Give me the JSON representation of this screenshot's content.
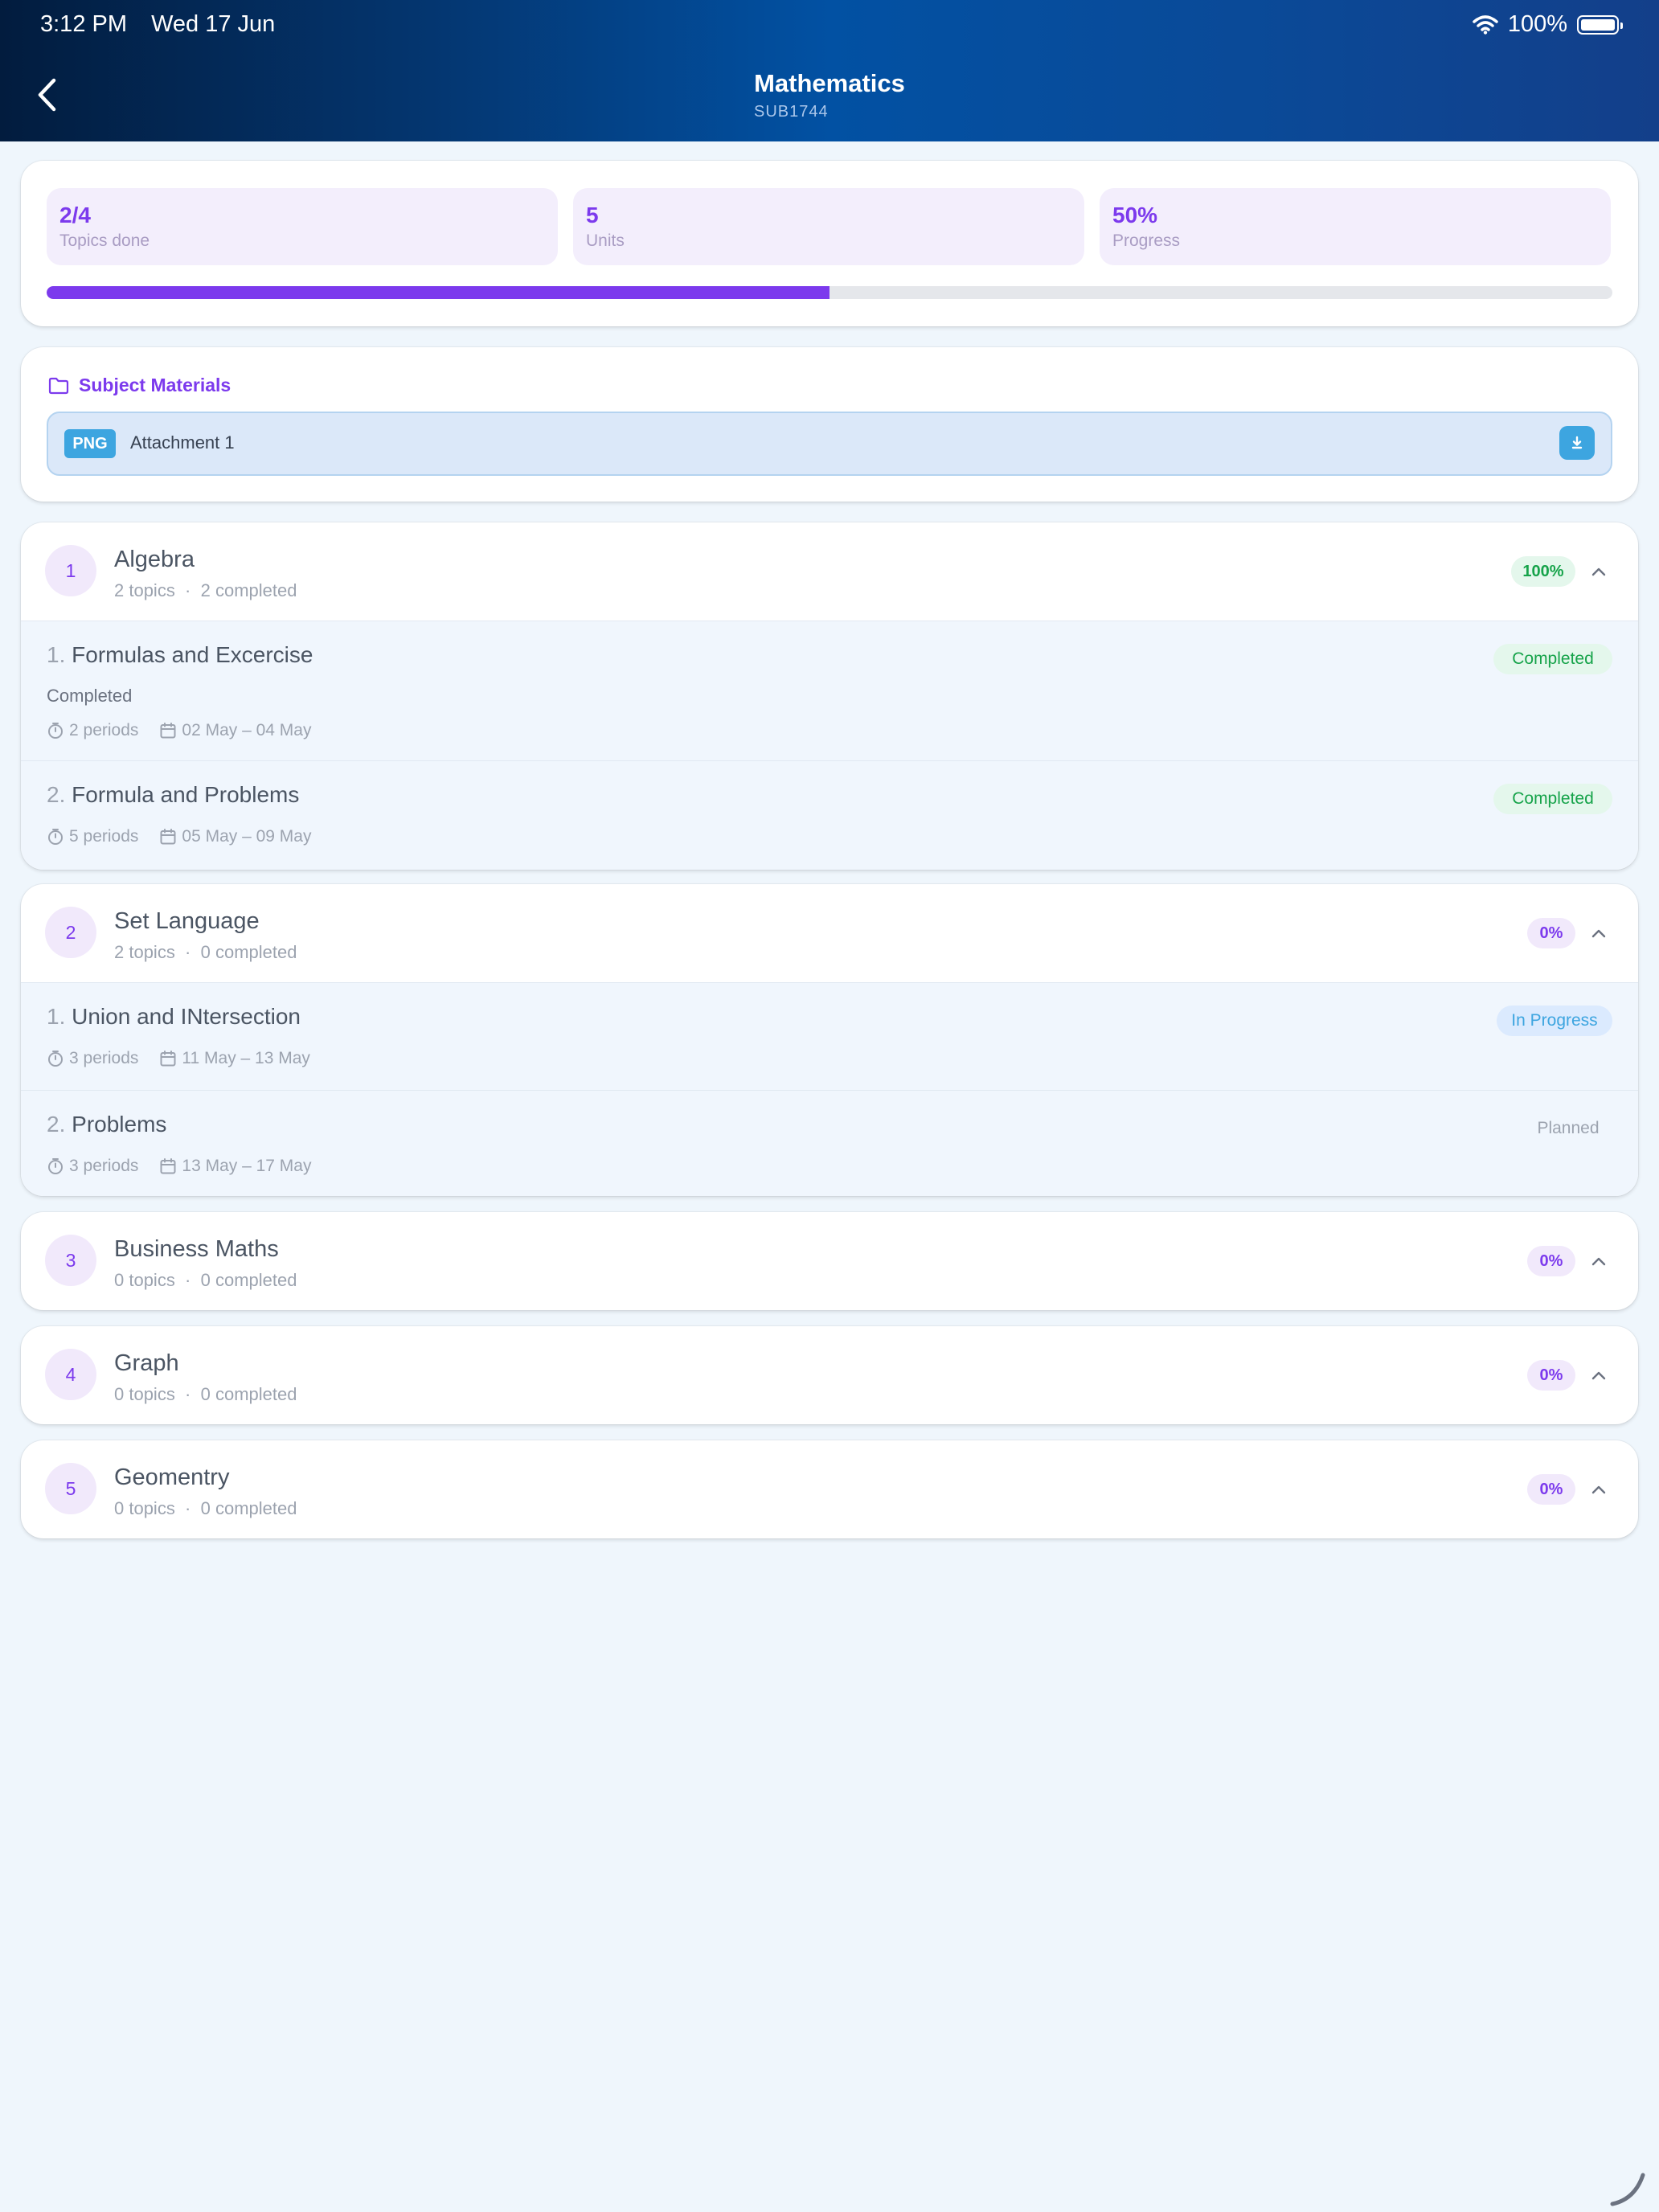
{
  "status_bar": {
    "time": "3:12 PM",
    "date": "Wed 17 Jun",
    "battery": "100%"
  },
  "header": {
    "title": "Mathematics",
    "code": "SUB1744"
  },
  "summary": {
    "stats": [
      {
        "value": "2/4",
        "label": "Topics done"
      },
      {
        "value": "5",
        "label": "Units"
      },
      {
        "value": "50%",
        "label": "Progress"
      }
    ],
    "progress_fraction": 0.5
  },
  "materials": {
    "title": "Subject Materials",
    "attachments": [
      {
        "type": "PNG",
        "name": "Attachment 1"
      }
    ]
  },
  "units": [
    {
      "number": "1",
      "name": "Algebra",
      "topics": "2 topics",
      "completed": "2 completed",
      "percent": "100%",
      "topic_items": [
        {
          "index": "1.",
          "title": "Formulas and Excercise",
          "status": "Completed",
          "note": "Completed",
          "periods": "2 periods",
          "dates": "02 May – 04 May"
        },
        {
          "index": "2.",
          "title": "Formula and Problems",
          "status": "Completed",
          "periods": "5 periods",
          "dates": "05 May – 09 May"
        }
      ]
    },
    {
      "number": "2",
      "name": "Set Language",
      "topics": "2 topics",
      "completed": "0 completed",
      "percent": "0%",
      "topic_items": [
        {
          "index": "1.",
          "title": "Union and INtersection",
          "status": "In Progress",
          "periods": "3 periods",
          "dates": "11 May – 13 May"
        },
        {
          "index": "2.",
          "title": "Problems",
          "status": "Planned",
          "periods": "3 periods",
          "dates": "13 May – 17 May"
        }
      ]
    },
    {
      "number": "3",
      "name": "Business Maths",
      "topics": "0 topics",
      "completed": "0 completed",
      "percent": "0%"
    },
    {
      "number": "4",
      "name": "Graph",
      "topics": "0 topics",
      "completed": "0 completed",
      "percent": "0%"
    },
    {
      "number": "5",
      "name": "Geomentry",
      "topics": "0 topics",
      "completed": "0 completed",
      "percent": "0%"
    }
  ],
  "colors": {
    "accent": "#7c3aed",
    "success": "#16a34a",
    "info": "#3da5e0",
    "background": "#eff6fc"
  }
}
